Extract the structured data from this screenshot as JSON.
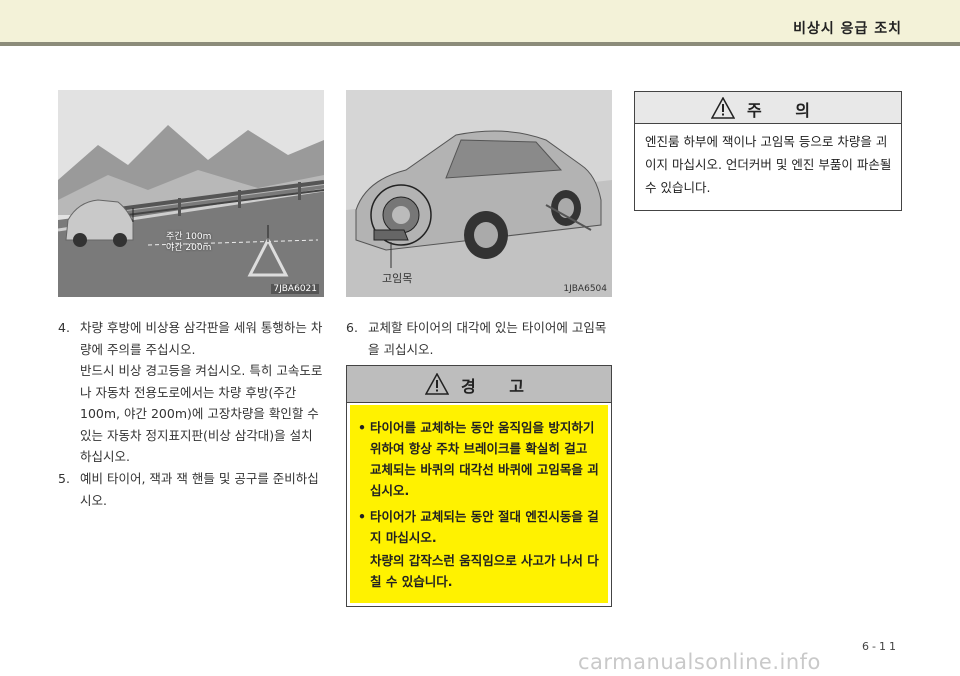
{
  "header": {
    "title": "비상시 응급 조치"
  },
  "figure1": {
    "code": "7JBA6021",
    "distance_day": "주간 100m",
    "distance_night": "야간 200m"
  },
  "figure2": {
    "code": "1JBA6504",
    "label": "고임목"
  },
  "instructions": [
    {
      "num": "4.",
      "text": "차량 후방에 비상용 삼각판을 세워 통행하는 차량에 주의를 주십시오.",
      "text2": "반드시 비상 경고등을 켜십시오. 특히 고속도로나 자동차 전용도로에서는 차량 후방(주간 100m, 야간 200m)에 고장차량을 확인할 수 있는 자동차 정지표지판(비상 삼각대)을 설치하십시오."
    },
    {
      "num": "5.",
      "text": "예비 타이어, 잭과 잭 핸들 및 공구를 준비하십시오."
    },
    {
      "num": "6.",
      "text": "교체할 타이어의 대각에 있는 타이어에 고임목을 괴십시오."
    }
  ],
  "warning": {
    "title": "경 고",
    "items": [
      "타이어를 교체하는 동안 움직임을 방지하기 위하여 항상 주차 브레이크를 확실히 걸고 교체되는 바퀴의 대각선 바퀴에 고임목을 괴십시오.",
      "타이어가 교체되는 동안 절대 엔진시동을 걸지 마십시오.",
      "차량의 갑작스런 움직임으로 사고가 나서 다칠 수 있습니다."
    ]
  },
  "caution": {
    "title": "주 의",
    "text": "엔진룸 하부에 잭이나 고임목 등으로 차량을 괴이지 마십시오. 언더커버 및 엔진 부품이 파손될 수 있습니다."
  },
  "footer": {
    "page": "6-11",
    "watermark": "carmanualsonline.info"
  }
}
